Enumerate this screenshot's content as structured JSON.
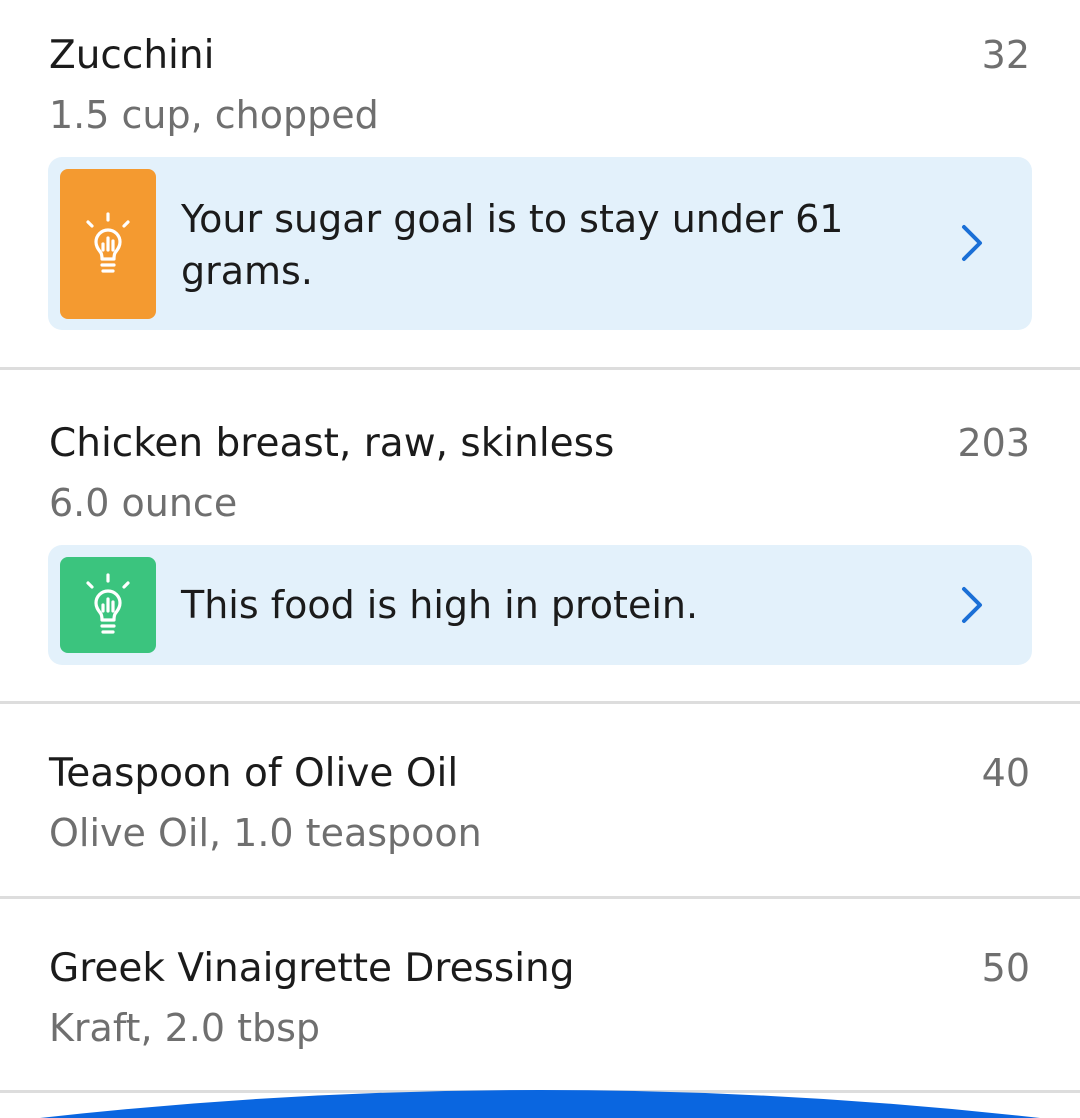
{
  "foods": [
    {
      "name": "Zucchini",
      "serving": "1.5 cup, chopped",
      "calories": "32",
      "insight": {
        "text": "Your sugar goal is to stay under 61 grams.",
        "badge_color": "#f49a30",
        "icon": "lightbulb-icon"
      }
    },
    {
      "name": "Chicken breast, raw, skinless",
      "serving": "6.0 ounce",
      "calories": "203",
      "insight": {
        "text": "This food is high in protein.",
        "badge_color": "#3bc47e",
        "icon": "lightbulb-icon"
      }
    },
    {
      "name": "Teaspoon of Olive Oil",
      "serving": "Olive Oil, 1.0 teaspoon",
      "calories": "40"
    },
    {
      "name": "Greek Vinaigrette Dressing",
      "serving": "Kraft, 2.0 tbsp",
      "calories": "50"
    }
  ],
  "colors": {
    "accent": "#1a6fd6",
    "card_background": "#e3f1fb",
    "divider": "#dddddd",
    "bottom_button": "#0a66e0"
  }
}
